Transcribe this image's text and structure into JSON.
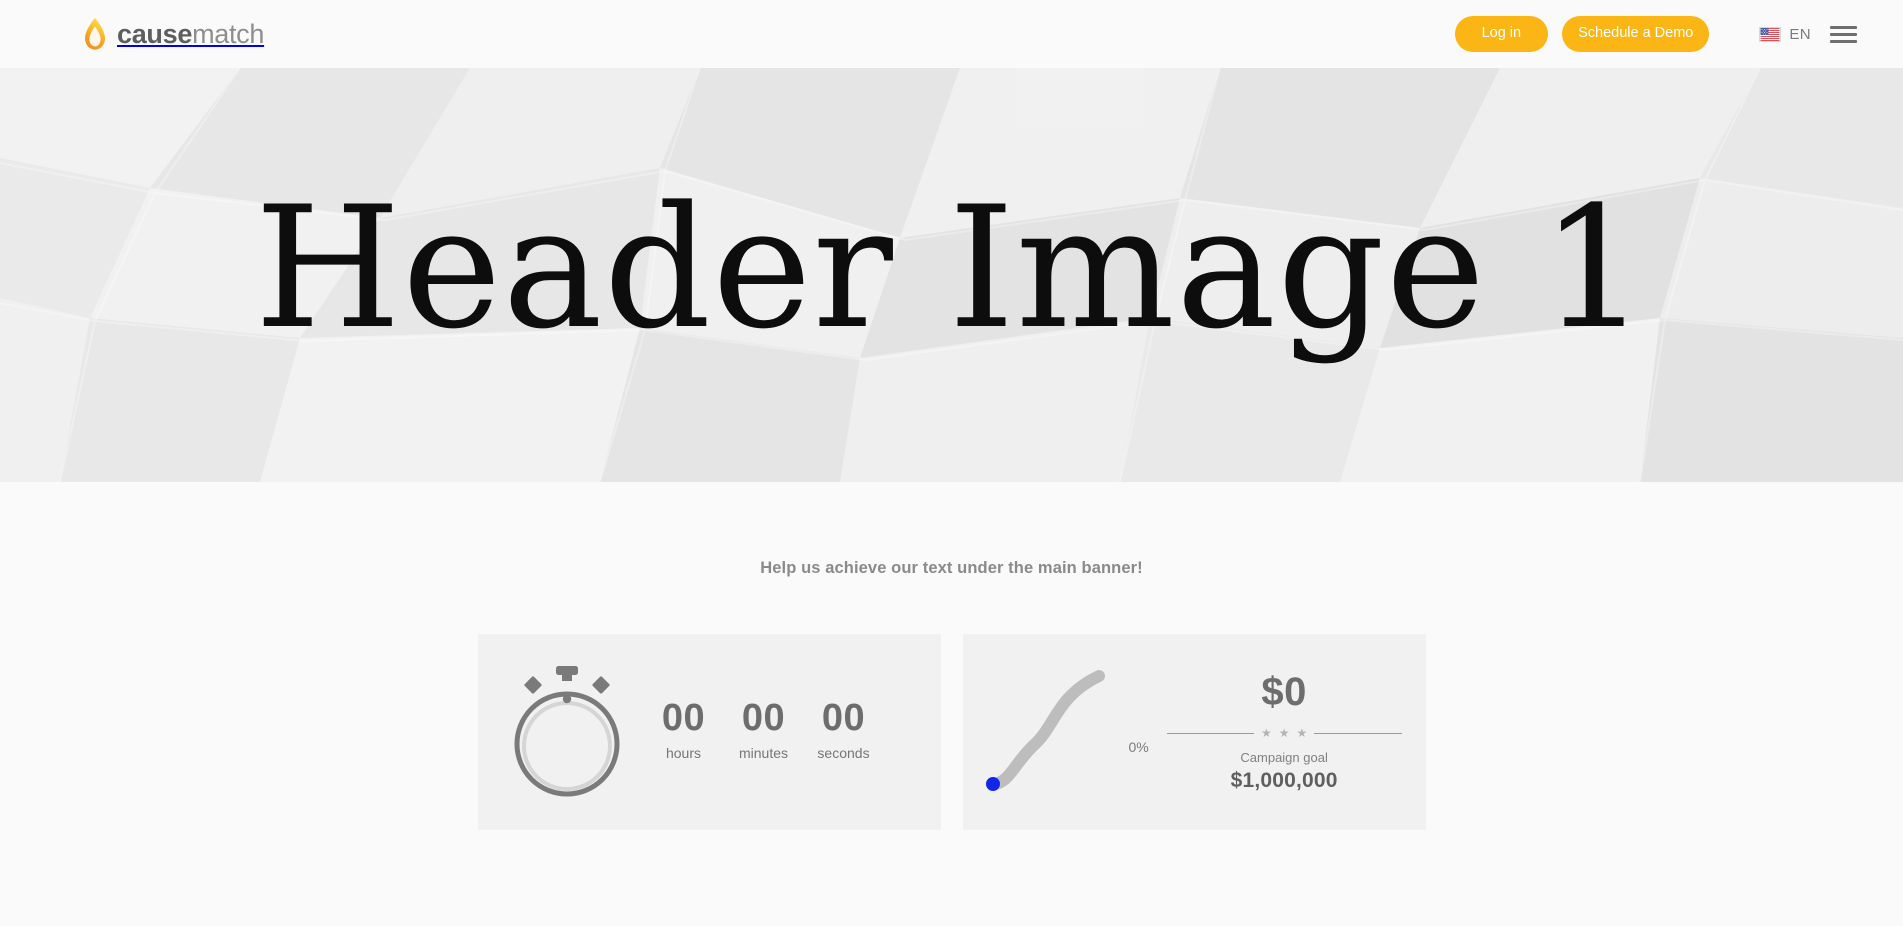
{
  "brand": {
    "name_bold": "cause",
    "name_light": "match",
    "flame_colors": [
      "#f6a21e",
      "#fdd744",
      "#ef8c22"
    ]
  },
  "topnav": {
    "login_label": "Log in",
    "demo_label": "Schedule a Demo",
    "language_code": "EN",
    "flag_name": "us-flag-icon",
    "menu_name": "hamburger-menu-icon",
    "button_color": "#fbb515"
  },
  "hero": {
    "title": "Header Image 1"
  },
  "main": {
    "tagline": "Help us achieve our text under the main banner!"
  },
  "countdown": {
    "icon_name": "stopwatch-icon",
    "units": [
      {
        "value": "00",
        "label": "hours"
      },
      {
        "value": "00",
        "label": "minutes"
      },
      {
        "value": "00",
        "label": "seconds"
      }
    ]
  },
  "goal": {
    "percent": "0%",
    "raised": "$0",
    "goal_label": "Campaign goal",
    "goal_amount": "$1,000,000",
    "stars": [
      "★",
      "★",
      "★"
    ],
    "marker_color": "#1026e8",
    "curve_color": "#bdbdbd"
  }
}
